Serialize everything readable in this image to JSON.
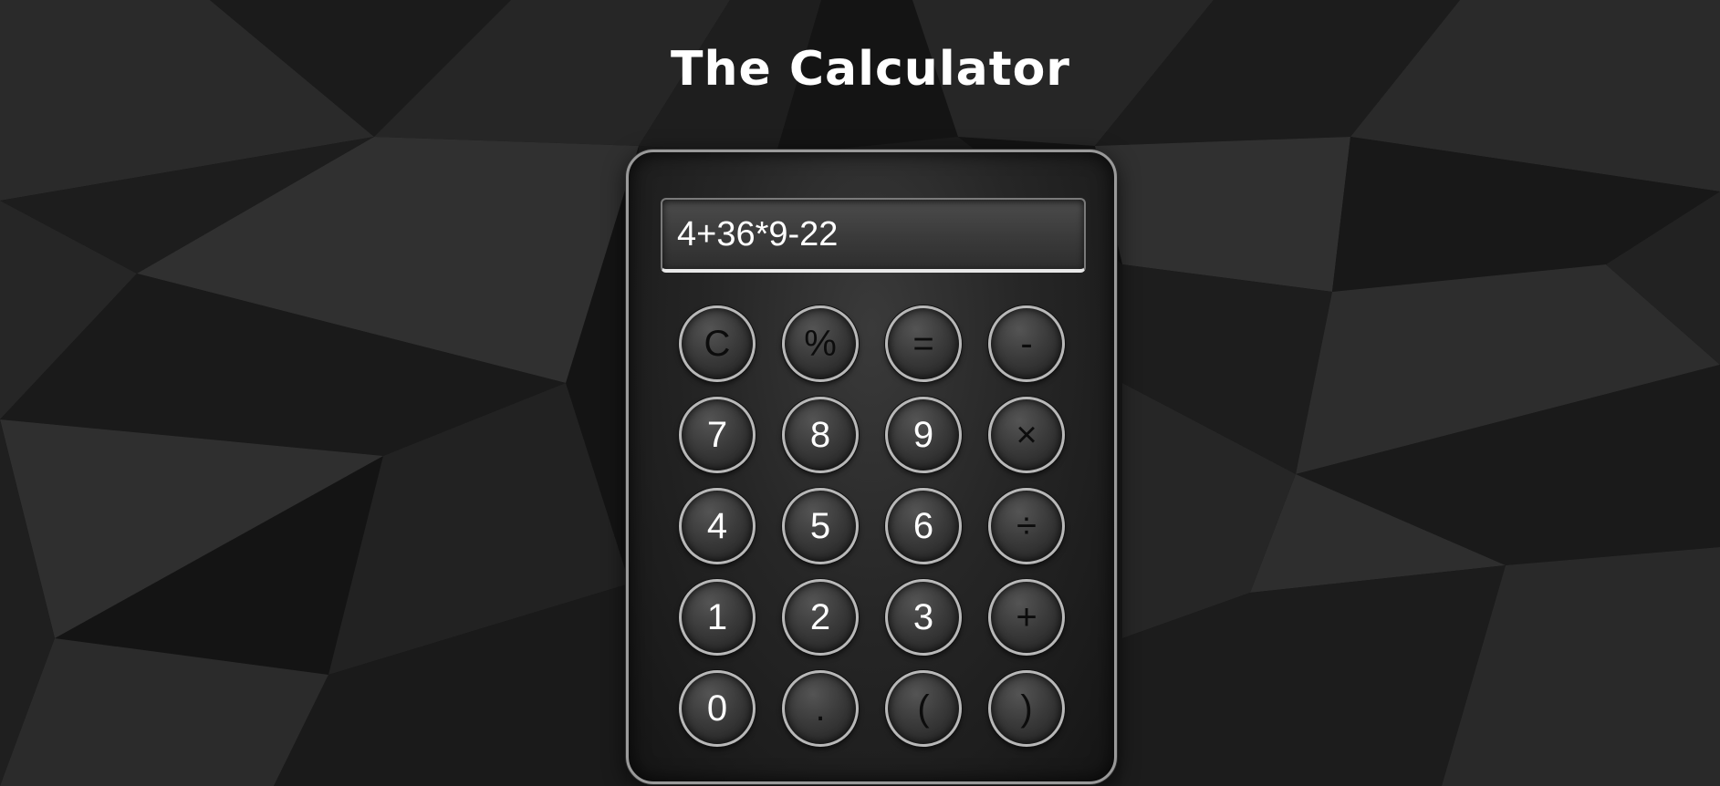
{
  "page": {
    "title": "The Calculator"
  },
  "display": {
    "value": "4+36*9-22"
  },
  "keys": {
    "clear": "C",
    "percent": "%",
    "equals": "=",
    "minus": "-",
    "seven": "7",
    "eight": "8",
    "nine": "9",
    "multiply": "×",
    "four": "4",
    "five": "5",
    "six": "6",
    "divide": "÷",
    "one": "1",
    "two": "2",
    "three": "3",
    "plus": "+",
    "zero": "0",
    "decimal": ".",
    "open_paren": "(",
    "close_paren": ")"
  },
  "colors": {
    "background": "#151515",
    "calculator_border": "#9a9a9a",
    "key_border": "#b8b8b8",
    "light_key_text": "#ffffff",
    "dark_key_text": "#0c0c0c"
  }
}
